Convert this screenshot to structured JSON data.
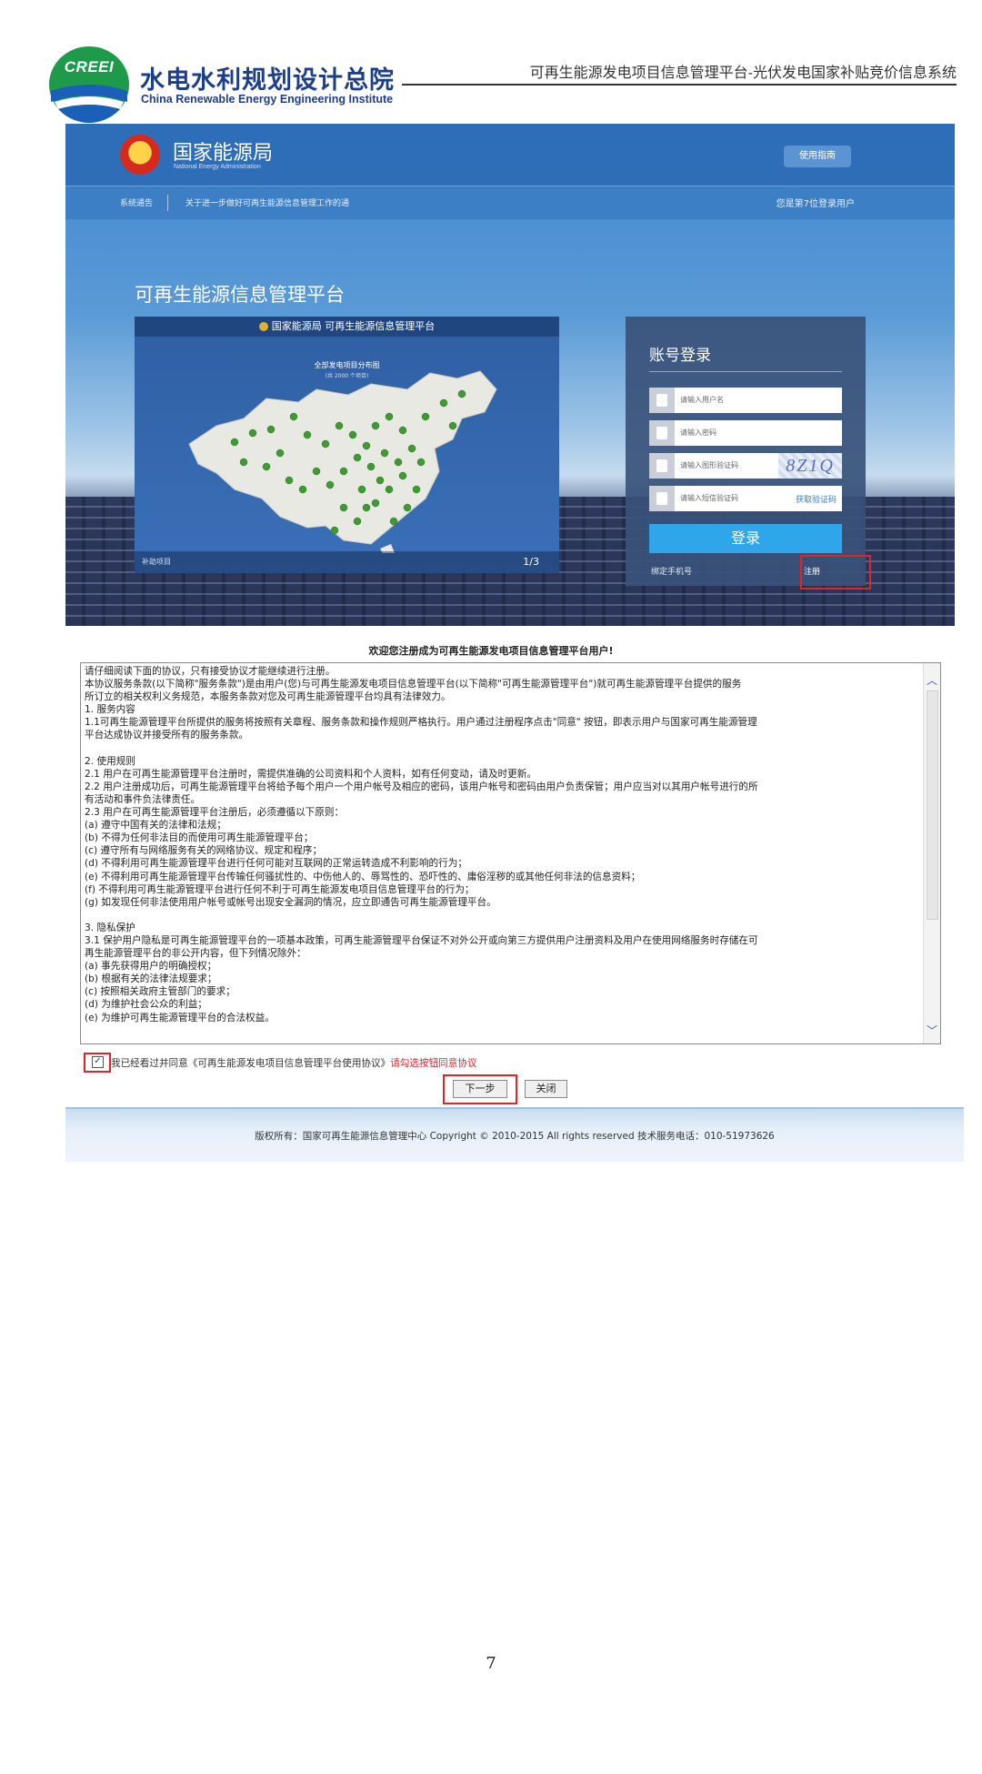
{
  "doc_header": {
    "logo_word": "CREEI",
    "org_name_cn": "水电水利规划设计总院",
    "org_name_en": "China Renewable Energy Engineering Institute",
    "doc_title": "可再生能源发电项目信息管理平台-光伏发电国家补贴竞价信息系统"
  },
  "portal": {
    "agency_name": "国家能源局",
    "agency_name_en": "National Energy Administration",
    "guide_button": "使用指南",
    "notice_label": "系统通告",
    "notice_text": "关于进一步做好可再生能源信息管理工作的通",
    "login_count": "您是第7位登录用户",
    "platform_title": "可再生能源信息管理平台",
    "map_panel": {
      "header": "国家能源局   可再生能源信息管理平台",
      "subtitle": "全部发电项目分布图",
      "subnote": "(共 2000 个项目)",
      "footer_left": "补助项目",
      "pager": "1/3"
    },
    "login": {
      "title": "账号登录",
      "username_placeholder": "请输入用户名",
      "password_placeholder": "请输入密码",
      "captcha_placeholder": "请输入图形验证码",
      "captcha_text": "8Z1Q",
      "sms_placeholder": "请输入短信验证码",
      "sms_button": "获取验证码",
      "login_button": "登录",
      "bind_phone": "绑定手机号",
      "register": "注册"
    }
  },
  "agreement": {
    "welcome": "欢迎您注册成为可再生能源发电项目信息管理平台用户!",
    "lines": [
      "       请仔细阅读下面的协议，只有接受协议才能继续进行注册。",
      "本协议服务条款(以下简称\"服务条款\")是由用户(您)与可再生能源发电项目信息管理平台(以下简称\"可再生能源管理平台\")就可再生能源管理平台提供的服务",
      "所订立的相关权利义务规范，本服务条款对您及可再生能源管理平台均具有法律效力。",
      "1. 服务内容",
      "1.1可再生能源管理平台所提供的服务将按照有关章程、服务条款和操作规则严格执行。用户通过注册程序点击\"同意\" 按钮，即表示用户与国家可再生能源管理",
      "平台达成协议并接受所有的服务条款。",
      "",
      "2. 使用规则",
      "2.1 用户在可再生能源管理平台注册时，需提供准确的公司资料和个人资料，如有任何变动，请及时更新。",
      "2.2 用户注册成功后，可再生能源管理平台将给予每个用户一个用户帐号及相应的密码，该用户帐号和密码由用户负责保管；用户应当对以其用户帐号进行的所",
      "有活动和事件负法律责任。",
      "2.3 用户在可再生能源管理平台注册后，必须遵循以下原则：",
      "(a) 遵守中国有关的法律和法规；",
      "(b) 不得为任何非法目的而使用可再生能源管理平台；",
      "(c) 遵守所有与网络服务有关的网络协议、规定和程序；",
      "(d) 不得利用可再生能源管理平台进行任何可能对互联网的正常运转造成不利影响的行为；",
      "(e) 不得利用可再生能源管理平台传输任何骚扰性的、中伤他人的、辱骂性的、恐吓性的、庸俗淫秽的或其他任何非法的信息资料；",
      "(f) 不得利用可再生能源管理平台进行任何不利于可再生能源发电项目信息管理平台的行为；",
      "(g) 如发现任何非法使用用户帐号或帐号出现安全漏洞的情况，应立即通告可再生能源管理平台。",
      "",
      "3. 隐私保护",
      "3.1 保护用户隐私是可再生能源管理平台的一项基本政策，可再生能源管理平台保证不对外公开或向第三方提供用户注册资料及用户在使用网络服务时存储在可",
      "再生能源管理平台的非公开内容，但下列情况除外：",
      "(a) 事先获得用户的明确授权；",
      "(b) 根据有关的法律法规要求；",
      "(c) 按照相关政府主管部门的要求；",
      "(d) 为维护社会公众的利益；",
      "(e) 为维护可再生能源管理平台的合法权益。"
    ],
    "agree_text": "我已经看过并同意《可再生能源发电项目信息管理平台使用协议》",
    "agree_warning": "请勾选按钮同意协议",
    "next_button": "下一步",
    "close_button": "关闭"
  },
  "footer": {
    "copyright": "版权所有：国家可再生能源信息管理中心  Copyright © 2010-2015 All rights reserved  技术服务电话：010-51973626"
  },
  "page_number": "7"
}
